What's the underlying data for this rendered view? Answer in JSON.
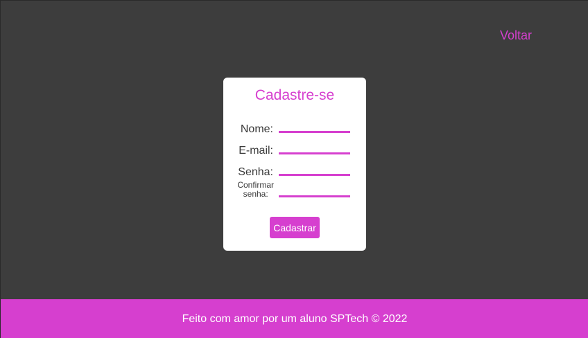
{
  "header": {
    "back_link": "Voltar"
  },
  "form": {
    "title": "Cadastre-se",
    "fields": [
      {
        "label": "Nome:",
        "value": ""
      },
      {
        "label": "E-mail:",
        "value": ""
      },
      {
        "label": "Senha:",
        "value": ""
      },
      {
        "label_line1": "Confirmar",
        "label_line2": "senha:",
        "value": ""
      }
    ],
    "submit_label": "Cadastrar"
  },
  "footer": {
    "text": "Feito com amor por um aluno SPTech © 2022"
  },
  "colors": {
    "background": "#3d3d3d",
    "accent": "#d63fcf",
    "card": "#ffffff",
    "text": "#3a3a3a"
  }
}
